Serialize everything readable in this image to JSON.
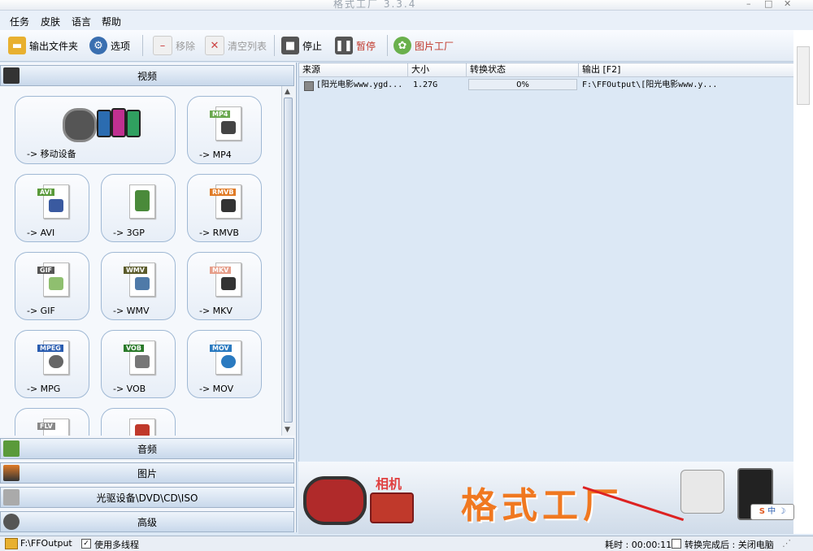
{
  "window": {
    "title": "格式工厂  3.3.4"
  },
  "menu": [
    "任务",
    "皮肤",
    "语言",
    "帮助"
  ],
  "toolbar": {
    "output_folder": "输出文件夹",
    "options": "选项",
    "remove": "移除",
    "clear_list": "清空列表",
    "stop": "停止",
    "pause": "暂停",
    "picture_factory": "图片工厂"
  },
  "categories": {
    "video": "视频",
    "audio": "音频",
    "picture": "图片",
    "rom": "光驱设备\\DVD\\CD\\ISO",
    "advanced": "高级"
  },
  "formats": [
    {
      "label": "-> 移动设备",
      "icon": "mobile-device-icon"
    },
    {
      "label": "-> MP4",
      "tag": "MP4",
      "color": "#6aa84f"
    },
    {
      "label": "-> AVI",
      "tag": "AVI",
      "color": "#5a9a3a"
    },
    {
      "label": "-> 3GP",
      "tag": "",
      "color": "#4a8a3a"
    },
    {
      "label": "-> RMVB",
      "tag": "RMVB",
      "color": "#e07b27"
    },
    {
      "label": "-> GIF",
      "tag": "GIF",
      "color": "#555555"
    },
    {
      "label": "-> WMV",
      "tag": "WMV",
      "color": "#5b5b2b"
    },
    {
      "label": "-> MKV",
      "tag": "MKV",
      "color": "#e69e8a"
    },
    {
      "label": "-> MPG",
      "tag": "MPEG",
      "color": "#2a5db0"
    },
    {
      "label": "-> VOB",
      "tag": "VOB",
      "color": "#2a7a2a"
    },
    {
      "label": "-> MOV",
      "tag": "MOV",
      "color": "#2a7ac0"
    },
    {
      "label": "",
      "tag": "FLV",
      "color": "#888888"
    },
    {
      "label": "",
      "tag": "",
      "color": "#c0392b"
    }
  ],
  "list": {
    "columns": {
      "source": "来源",
      "size": "大小",
      "status": "转换状态",
      "output": "输出 [F2]"
    },
    "rows": [
      {
        "source": "[阳光电影www.ygd...",
        "size": "1.27G",
        "progress": "0%",
        "output": "F:\\FFOutput\\[阳光电影www.y..."
      }
    ]
  },
  "banner": {
    "camera_label": "相机",
    "title": "格式工厂"
  },
  "status": {
    "output_path": "F:\\FFOutput",
    "multithread": "使用多线程",
    "elapsed": "耗时 : 00:00:11",
    "after_done": "转换完成后 : 关闭电脑"
  },
  "colors": {
    "banner_title": "#f07820",
    "accent": "#3a6fb0"
  }
}
